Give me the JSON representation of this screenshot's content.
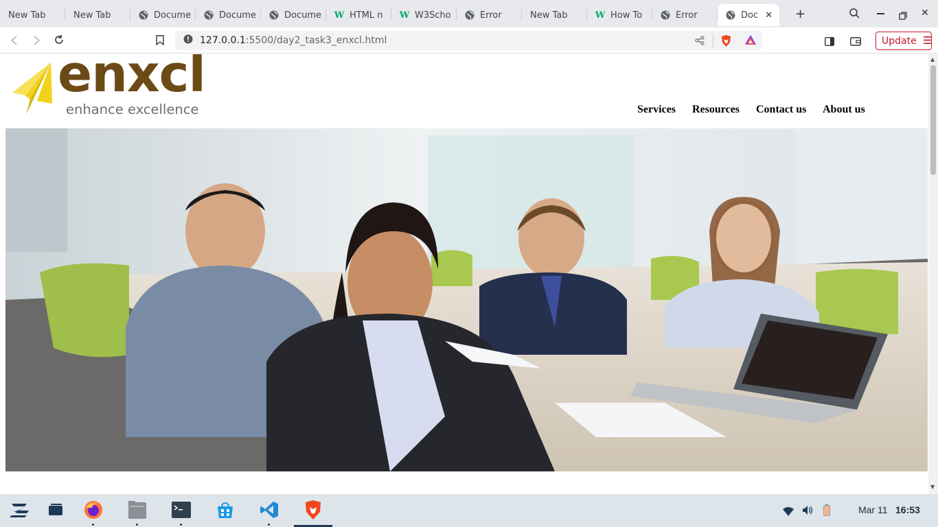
{
  "browser": {
    "tabs": [
      {
        "label": "New Tab",
        "icon": "none"
      },
      {
        "label": "New Tab",
        "icon": "none"
      },
      {
        "label": "Docume",
        "icon": "globe-icon"
      },
      {
        "label": "Docume",
        "icon": "globe-icon"
      },
      {
        "label": "Docume",
        "icon": "globe-icon"
      },
      {
        "label": "HTML n",
        "icon": "w3schools-icon"
      },
      {
        "label": "W3Scho",
        "icon": "w3schools-icon"
      },
      {
        "label": "Error",
        "icon": "globe-icon"
      },
      {
        "label": "New Tab",
        "icon": "none"
      },
      {
        "label": "How To",
        "icon": "w3schools-icon"
      },
      {
        "label": "Error",
        "icon": "globe-icon"
      }
    ],
    "active_tab": {
      "label": "Doc",
      "icon": "globe-icon"
    },
    "url": {
      "host": "127.0.0.1",
      "rest": ":5500/day2_task3_enxcl.html"
    },
    "update_label": "Update"
  },
  "site": {
    "logo": {
      "word": "enxcl",
      "tagline": "enhance excellence"
    },
    "nav": [
      "Services",
      "Resources",
      "Contact us",
      "About us"
    ],
    "hero_alt": "Team meeting"
  },
  "taskbar": {
    "date": "Mar 11",
    "time": "16:53"
  },
  "colors": {
    "logo_brown": "#6b4a16",
    "logo_gray": "#6d6d6d",
    "logo_yellow": "#f2d21a",
    "brave_orange": "#f0461f",
    "update_red": "#c8192b",
    "w3_green": "#04aa6d"
  }
}
